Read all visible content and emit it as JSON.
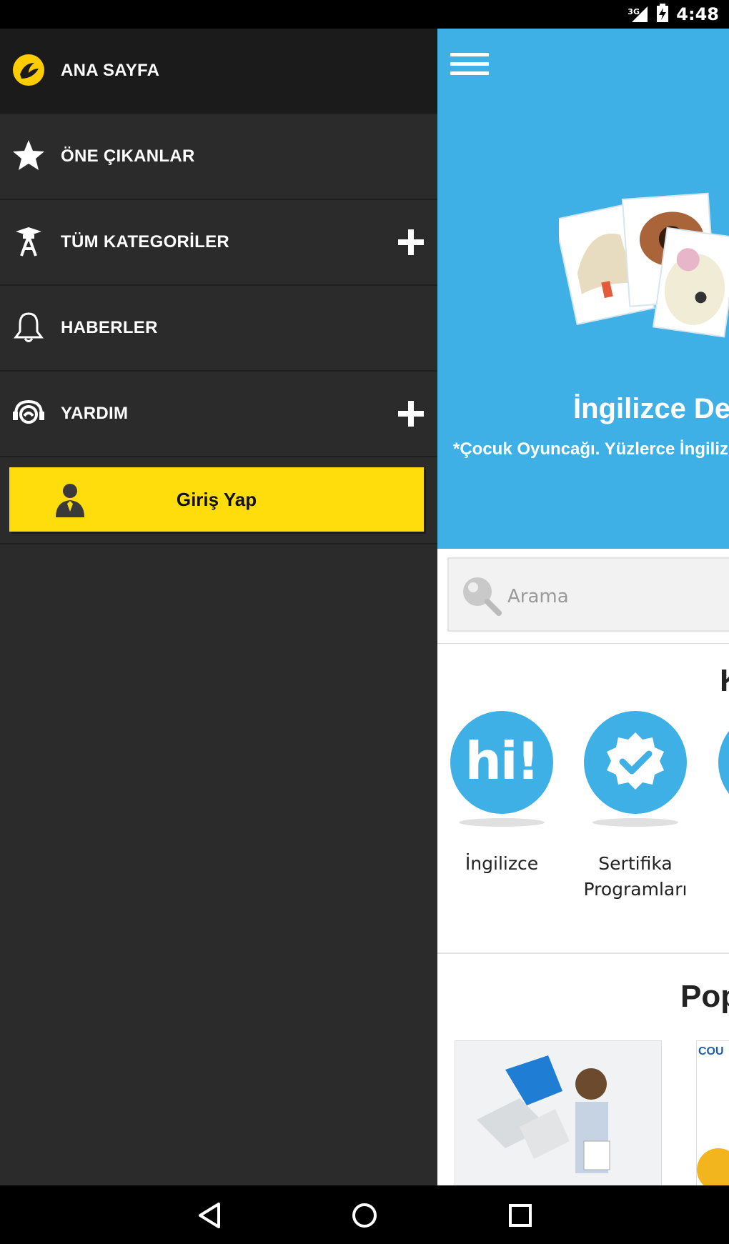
{
  "status_bar": {
    "network": "3G",
    "time": "4:48"
  },
  "drawer": {
    "items": [
      {
        "label": "ANA SAYFA",
        "icon": "turkcell-logo-icon"
      },
      {
        "label": "ÖNE ÇIKANLAR",
        "icon": "star-icon"
      },
      {
        "label": "TÜM KATEGORİLER",
        "icon": "graduation-icon",
        "expand": "plus-icon"
      },
      {
        "label": "HABERLER",
        "icon": "bell-icon"
      },
      {
        "label": "YARDIM",
        "icon": "headset-icon",
        "expand": "plus-icon"
      }
    ],
    "login_label": "Giriş Yap"
  },
  "main": {
    "hero_title": "İngilizce Deyi",
    "hero_subtitle": "*Çocuk Oyuncağı. Yüzlerce İngilizce",
    "search_placeholder": "Arama",
    "categories_heading": "K",
    "categories": [
      {
        "label_line1": "İngilizce",
        "label_line2": "",
        "icon_text": "hi!"
      },
      {
        "label_line1": "Sertifika",
        "label_line2": "Programları",
        "icon": "badge-check-icon"
      }
    ],
    "popular_heading": "Pop",
    "popular_card_text": "COU"
  },
  "colors": {
    "accent": "#ffdc0b",
    "hero_blue": "#3fb0e6",
    "drawer_bg": "#2b2b2b"
  }
}
